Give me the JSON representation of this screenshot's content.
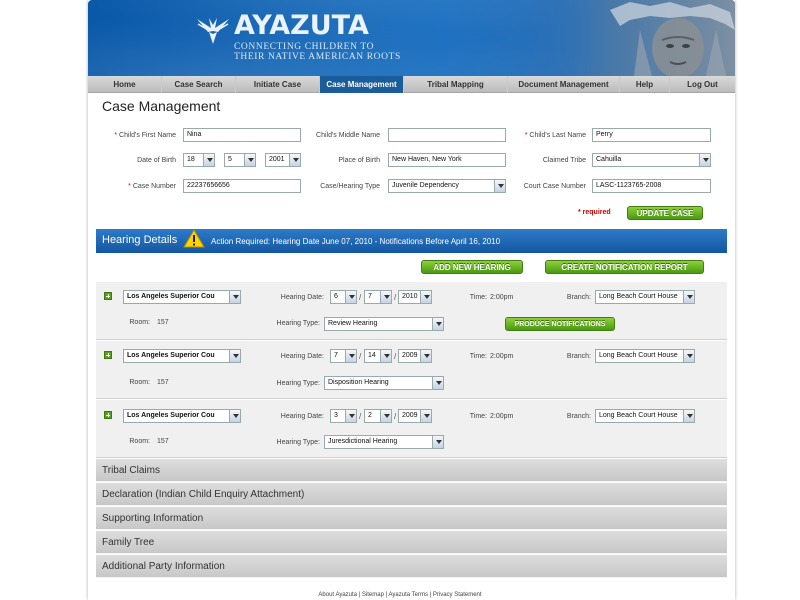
{
  "brand": {
    "name": "AYAZUTA",
    "tagline_1": "CONNECTING CHILDREN TO",
    "tagline_2": "THEIR NATIVE AMERICAN ROOTS"
  },
  "nav": {
    "items": [
      {
        "label": "Home"
      },
      {
        "label": "Case Search"
      },
      {
        "label": "Initiate Case"
      },
      {
        "label": "Case Management"
      },
      {
        "label": "Tribal Mapping"
      },
      {
        "label": "Document Management"
      },
      {
        "label": "Help"
      },
      {
        "label": "Log Out"
      }
    ],
    "active": "Case Management"
  },
  "page_title": "Case Management",
  "form": {
    "first_name_label": "Child's First Name",
    "first_name": "Nina",
    "middle_name_label": "Child's Middle Name",
    "middle_name": "",
    "last_name_label": "Child's Last Name",
    "last_name": "Perry",
    "dob_label": "Date of Birth",
    "dob_day": "18",
    "dob_month": "5",
    "dob_year": "2001",
    "birthplace_label": "Place of Birth",
    "birthplace": "New Haven, New York",
    "tribe_label": "Claimed Tribe",
    "tribe": "Cahuilla",
    "case_number_label": "Case Number",
    "case_number": "22237656656",
    "hearing_type_label": "Case/Hearing Type",
    "hearing_type": "Juvenile Dependency",
    "court_case_label": "Court Case Number",
    "court_case": "LASC-1123765-2008",
    "required_asterisk": "*",
    "required_note": "* required",
    "update_button": "UPDATE CASE"
  },
  "hearing_details": {
    "title": "Hearing Details",
    "action_text": "Action Required: Hearing Date June 07, 2010 - Notifications Before April 16, 2010",
    "add_button": "ADD NEW HEARING",
    "report_button": "CREATE NOTIFICATION REPORT",
    "labels": {
      "date": "Hearing Date:",
      "time": "Time:",
      "branch": "Branch:",
      "room": "Room:",
      "type": "Hearing Type:",
      "slash": "/"
    },
    "produce_button": "PRODUCE NOTIFICATIONS",
    "hearings": [
      {
        "court": "Los Angeles Superior Cou",
        "d1": "6",
        "d2": "7",
        "year": "2010",
        "time": "2:00pm",
        "branch": "Long Beach Court House",
        "room": "157",
        "type": "Review Hearing"
      },
      {
        "court": "Los Angeles Superior Cou",
        "d1": "7",
        "d2": "14",
        "year": "2009",
        "time": "2:00pm",
        "branch": "Long Beach Court House",
        "room": "157",
        "type": "Disposition Hearing"
      },
      {
        "court": "Los Angeles Superior Cou",
        "d1": "3",
        "d2": "2",
        "year": "2009",
        "time": "2:00pm",
        "branch": "Long Beach Court House",
        "room": "157",
        "type": "Juresdictional Hearing"
      }
    ]
  },
  "sections": [
    "Tribal Claims",
    "Declaration (Indian Child Enquiry Attachment)",
    "Supporting Information",
    "Family Tree",
    "Additional Party Information"
  ],
  "footer": {
    "links": [
      "About Ayazuta",
      "Sitemap",
      "Ayazuta Terms",
      "Privacy Statement"
    ],
    "separator": " | "
  },
  "colors": {
    "header_blue": "#0a58a8",
    "nav_active": "#1b5c9b",
    "button_green": "#4a9a14",
    "required_red": "#cc0000"
  }
}
